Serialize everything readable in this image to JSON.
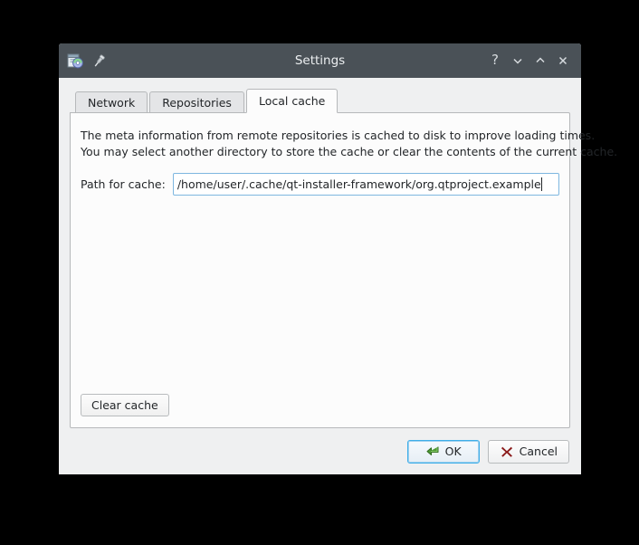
{
  "window": {
    "title": "Settings",
    "icon": "installer-package-icon",
    "pin_icon": "pin-icon",
    "controls": [
      {
        "name": "help-button",
        "icon": "question-mark-icon",
        "glyph": "?"
      },
      {
        "name": "minimize-button",
        "icon": "chevron-down-icon",
        "glyph": "⌄"
      },
      {
        "name": "maximize-button",
        "icon": "chevron-up-icon",
        "glyph": "⌃"
      },
      {
        "name": "close-button",
        "icon": "close-x-icon",
        "glyph": "×"
      }
    ]
  },
  "tabs": [
    {
      "label": "Network",
      "active": false
    },
    {
      "label": "Repositories",
      "active": false
    },
    {
      "label": "Local cache",
      "active": true
    }
  ],
  "local_cache": {
    "description_line1": "The meta information from remote repositories is cached to disk to improve loading times.",
    "description_line2": "You may select another directory to store the cache or clear the contents of the current cache.",
    "path_label": "Path for cache:",
    "path_value": "/home/user/.cache/qt-installer-framework/org.qtproject.example",
    "path_placeholder": "",
    "clear_cache_label": "Clear cache"
  },
  "footer": {
    "ok_label": "OK",
    "ok_icon": "green-enter-arrow-icon",
    "cancel_label": "Cancel",
    "cancel_icon": "red-x-icon"
  },
  "colors": {
    "titlebar": "#4a5157",
    "dialog_bg": "#eff0f1",
    "panel_bg": "#fcfcfc",
    "focus_blue": "#3daee9",
    "input_border": "#7eb7e0",
    "ok_icon_green": "#3c8a2e",
    "cancel_icon_red": "#8b1a1a",
    "desktop_bg": "#000000"
  }
}
